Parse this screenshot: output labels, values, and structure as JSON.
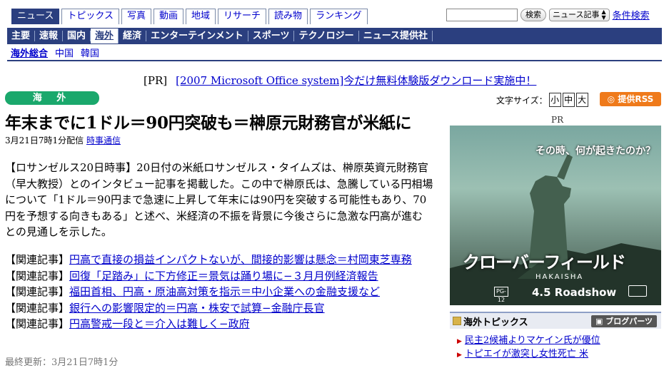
{
  "tabs": [
    "ニュース",
    "トピックス",
    "写真",
    "動画",
    "地域",
    "リサーチ",
    "読み物",
    "ランキング"
  ],
  "search": {
    "button": "検索",
    "select": "ニュース記事",
    "advanced": "条件検索"
  },
  "nav_main": [
    "主要",
    "速報",
    "国内",
    "海外",
    "経済",
    "エンターテインメント",
    "スポーツ",
    "テクノロジー",
    "ニュース提供社"
  ],
  "nav_sub": [
    "海外総合",
    "中国",
    "韓国"
  ],
  "pr": {
    "label": "[PR]",
    "text": "[2007 Microsoft Office system]今だけ無料体験版ダウンロード実施中！"
  },
  "category": "海 外",
  "font_size": {
    "label": "文字サイズ：",
    "small": "小",
    "medium": "中",
    "large": "大"
  },
  "rss": "提供RSS",
  "article": {
    "title": "年末までに1ドル＝90円突破も＝榊原元財務官が米紙に",
    "dateline": "3月21日7時1分配信",
    "source": "時事通信",
    "body": "【ロサンゼルス20日時事】20日付の米紙ロサンゼルス・タイムズは、榊原英資元財務官（早大教授）とのインタビュー記事を掲載した。この中で榊原氏は、急騰している円相場について「1ドル＝90円まで急速に上昇して年末には90円を突破する可能性もあり、70円を予想する向きもある」と述べ、米経済の不振を背景に今後さらに急激な円高が進むとの見通しを示した。"
  },
  "related": {
    "label": "【関連記事】",
    "items": [
      "円高で直接の損益インパクトないが、間接的影響は懸念＝村岡東芝専務",
      "回復「足踏み」に下方修正＝景気は踊り場に−３月月例経済報告",
      "福田首相、円高・原油高対策を指示＝中小企業への金融支援など",
      "銀行への影響限定的＝円高・株安で試算−金融庁長官",
      "円高警戒一段と＝介入は難しく−政府"
    ]
  },
  "cutoff_text": "最終更新：3月21日7時1分",
  "ad": {
    "label": "PR",
    "tagline": "その時、何が起きたのか？",
    "title": "クローバーフィールド",
    "subtitle": "HAKAISHA",
    "rating": "PG-12",
    "release": "4.5 Roadshow"
  },
  "topics": {
    "title": "海外トピックス",
    "parts_button": "ブログパーツ",
    "items": [
      "民主2候補よりマケイン氏が優位",
      "トピエイが激突し女性死亡 米"
    ]
  }
}
